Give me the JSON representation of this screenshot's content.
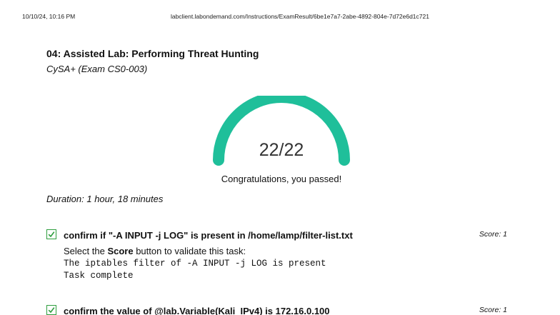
{
  "print_header": {
    "datetime": "10/10/24, 10:16 PM",
    "url": "labclient.labondemand.com/Instructions/ExamResult/6be1e7a7-2abe-4892-804e-7d72e6d1c721"
  },
  "lab": {
    "title": "04: Assisted Lab: Performing Threat Hunting",
    "subtitle": "CySA+ (Exam CS0-003)"
  },
  "result": {
    "score": "22/22",
    "score_fraction": 1.0,
    "message": "Congratulations, you passed!",
    "duration": "Duration: 1 hour, 18 minutes",
    "gauge_color": "#1fbf9a"
  },
  "tasks": [
    {
      "title": "confirm if \"-A INPUT -j LOG\" is present in /home/lamp/filter-list.txt",
      "score": "Score: 1",
      "instruction_prefix": "Select the ",
      "instruction_bold": "Score",
      "instruction_suffix": " button to validate this task:",
      "output_line_1": "The iptables filter of -A INPUT -j LOG is present",
      "output_line_2": "Task complete",
      "completed": true
    },
    {
      "title": "confirm the value of @lab.Variable(Kali_IPv4) is 172.16.0.100",
      "score": "Score: 1",
      "completed": true
    }
  ]
}
